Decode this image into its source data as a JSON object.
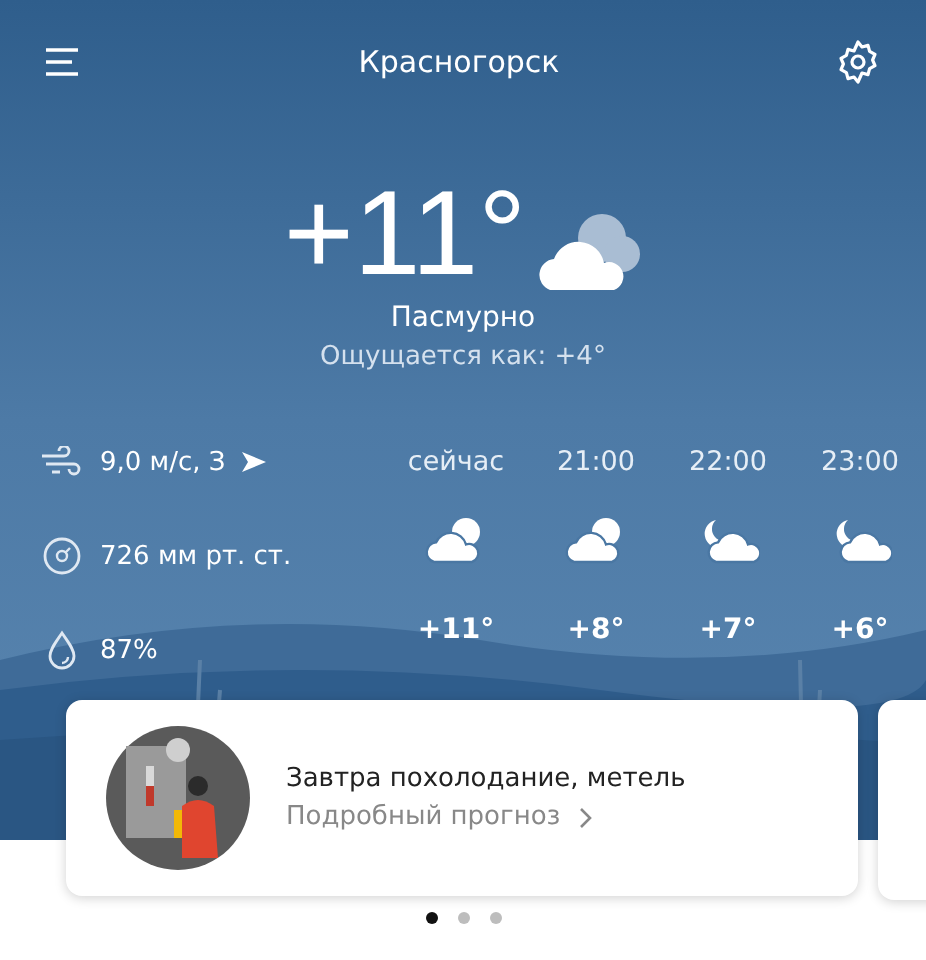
{
  "header": {
    "city": "Красногорск"
  },
  "current": {
    "temperature": "+11°",
    "condition": "Пасмурно",
    "feels_like": "Ощущается как: +4°"
  },
  "details": [
    {
      "kind": "wind",
      "text": "9,0 м/с, З"
    },
    {
      "kind": "pressure",
      "text": "726 мм рт. ст."
    },
    {
      "kind": "humidity",
      "text": "87%"
    }
  ],
  "hourly": [
    {
      "time": "сейчас",
      "kind": "cloudy",
      "temperature": "+11°"
    },
    {
      "time": "21:00",
      "kind": "cloudy",
      "temperature": "+8°"
    },
    {
      "time": "22:00",
      "kind": "night",
      "temperature": "+7°"
    },
    {
      "time": "23:00",
      "kind": "night",
      "temperature": "+6°"
    }
  ],
  "card": {
    "title": "Завтра похолодание, метель",
    "link": "Подробный прогноз"
  },
  "pager": [
    {
      "selected": true
    },
    {
      "selected": false
    },
    {
      "selected": false
    }
  ]
}
